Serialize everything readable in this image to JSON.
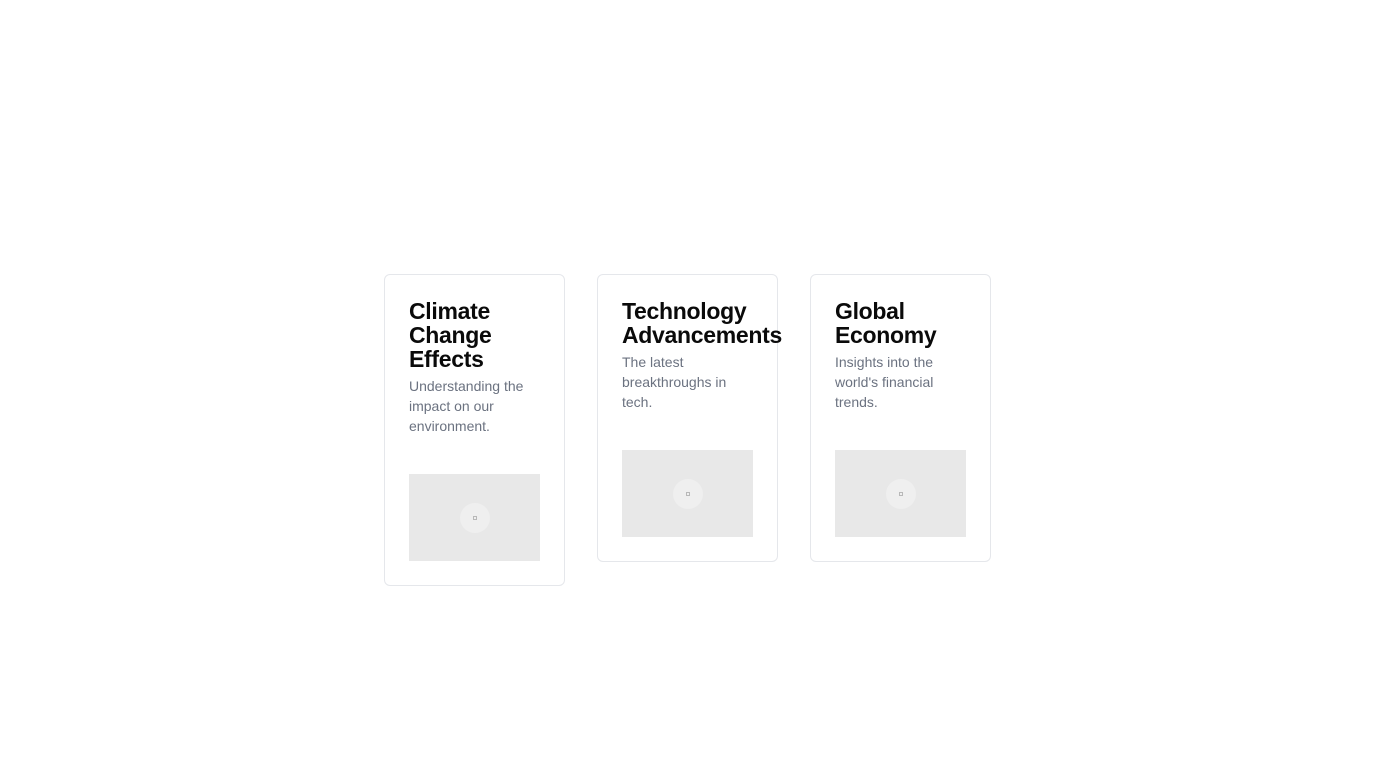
{
  "cards": [
    {
      "title": "Climate Change Effects",
      "description": "Understanding the impact on our environment.",
      "image_icon": "image-placeholder-icon"
    },
    {
      "title": "Technology Advancements",
      "description": "The latest breakthroughs in tech.",
      "image_icon": "image-placeholder-icon"
    },
    {
      "title": "Global Economy",
      "description": "Insights into the world's financial trends.",
      "image_icon": "image-placeholder-icon"
    }
  ],
  "colors": {
    "title": "#0a0a0a",
    "description": "#6b7280",
    "card_border": "#e5e7eb",
    "image_placeholder": "#e8e8e8"
  }
}
